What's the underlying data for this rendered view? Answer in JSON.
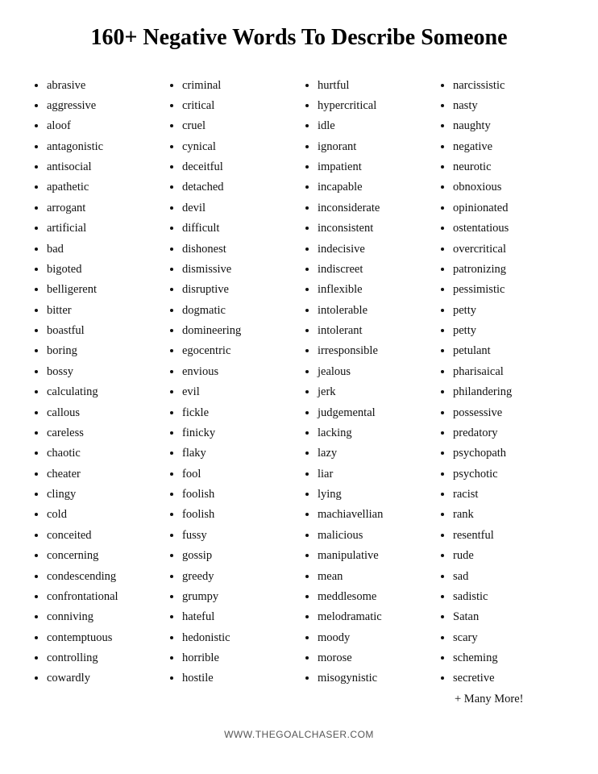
{
  "title": "160+ Negative Words To Describe Someone",
  "columns": [
    {
      "words": [
        "abrasive",
        "aggressive",
        "aloof",
        "antagonistic",
        "antisocial",
        "apathetic",
        "arrogant",
        "artificial",
        "bad",
        "bigoted",
        "belligerent",
        "bitter",
        "boastful",
        "boring",
        "bossy",
        "calculating",
        "callous",
        "careless",
        "chaotic",
        "cheater",
        "clingy",
        "cold",
        "conceited",
        "concerning",
        "condescending",
        "confrontational",
        "conniving",
        "contemptuous",
        "controlling",
        "cowardly"
      ]
    },
    {
      "words": [
        "criminal",
        "critical",
        "cruel",
        "cynical",
        "deceitful",
        "detached",
        "devil",
        "difficult",
        "dishonest",
        "dismissive",
        "disruptive",
        "dogmatic",
        "domineering",
        "egocentric",
        "envious",
        "evil",
        "fickle",
        "finicky",
        "flaky",
        "fool",
        "foolish",
        "foolish",
        "fussy",
        "gossip",
        "greedy",
        "grumpy",
        "hateful",
        "hedonistic",
        "horrible",
        "hostile"
      ]
    },
    {
      "words": [
        "hurtful",
        "hypercritical",
        "idle",
        "ignorant",
        "impatient",
        "incapable",
        "inconsiderate",
        "inconsistent",
        "indecisive",
        "indiscreet",
        "inflexible",
        "intolerable",
        "intolerant",
        "irresponsible",
        "jealous",
        "jerk",
        "judgemental",
        "lacking",
        "lazy",
        "liar",
        "lying",
        "machiavellian",
        "malicious",
        "manipulative",
        "mean",
        "meddlesome",
        "melodramatic",
        "moody",
        "morose",
        "misogynistic"
      ]
    },
    {
      "words": [
        "narcissistic",
        "nasty",
        "naughty",
        "negative",
        "neurotic",
        "obnoxious",
        "opinionated",
        "ostentatious",
        "overcritical",
        "patronizing",
        "pessimistic",
        "petty",
        "petty",
        "petulant",
        "pharisaical",
        "philandering",
        "possessive",
        "predatory",
        "psychopath",
        "psychotic",
        "racist",
        "rank",
        "resentful",
        "rude",
        "sad",
        "sadistic",
        "Satan",
        "scary",
        "scheming",
        "secretive"
      ]
    }
  ],
  "extra": "+ Many More!",
  "footer": "WWW.THEGOALCHASER.COM"
}
